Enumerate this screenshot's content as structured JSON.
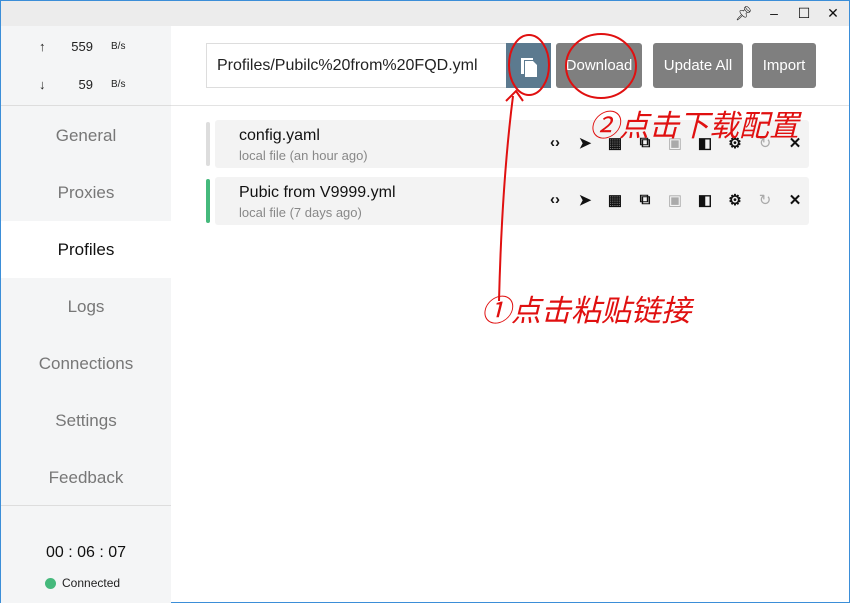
{
  "titlebar": {
    "pin": "pin-icon",
    "minimize": "minimize-icon",
    "maximize": "maximize-icon",
    "close": "close-icon"
  },
  "traffic": {
    "up_arrow": "↑",
    "up_value": "559",
    "up_unit": "B/s",
    "down_arrow": "↓",
    "down_value": "59",
    "down_unit": "B/s"
  },
  "nav": [
    {
      "label": "General"
    },
    {
      "label": "Proxies"
    },
    {
      "label": "Profiles"
    },
    {
      "label": "Logs"
    },
    {
      "label": "Connections"
    },
    {
      "label": "Settings"
    },
    {
      "label": "Feedback"
    }
  ],
  "footer": {
    "timer": "00 : 06 : 07",
    "status": "Connected",
    "status_color": "#45b97c"
  },
  "toolbar": {
    "url_value": "Profiles/Pubilc%20from%20FQD.yml",
    "download": "Download",
    "update_all": "Update All",
    "import": "Import"
  },
  "profiles": [
    {
      "name": "config.yaml",
      "sub": "local file (an hour ago)",
      "selected": false
    },
    {
      "name": "Pubic from V9999.yml",
      "sub": "local file (7 days ago)",
      "selected": true
    }
  ],
  "annotations": {
    "step1": "①点击粘贴链接",
    "step2": "②点击下载配置",
    "color": "#e01010"
  }
}
